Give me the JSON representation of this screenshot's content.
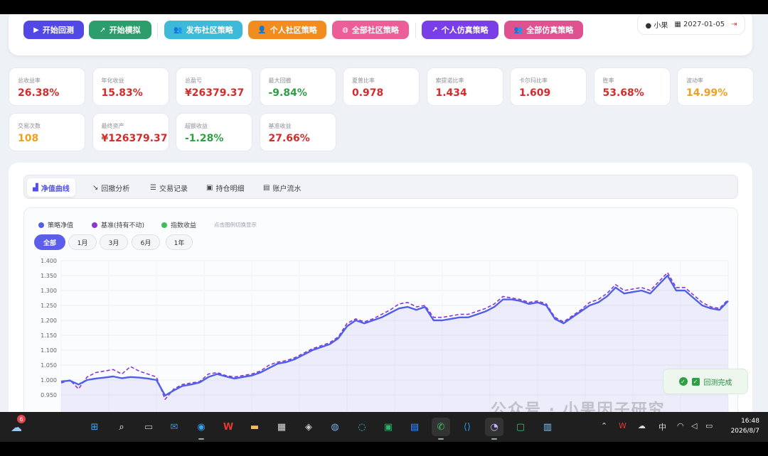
{
  "toolbar": {
    "buttons": [
      {
        "label": "开始回测",
        "icon": "play-icon",
        "color": "#5148e6",
        "glyph": "▶"
      },
      {
        "label": "开始模拟",
        "icon": "rocket-icon",
        "color": "#2c9d6c",
        "glyph": "➚"
      },
      {
        "label": "发布社区策略",
        "icon": "users-icon",
        "color": "#3fb9d9",
        "glyph": "👥"
      },
      {
        "label": "个人社区策略",
        "icon": "user-plus-icon",
        "color": "#f28c1e",
        "glyph": "👤"
      },
      {
        "label": "全部社区策略",
        "icon": "globe-icon",
        "color": "#ec5e97",
        "glyph": "◍"
      },
      {
        "label": "个人仿真策略",
        "icon": "chart-line-icon",
        "color": "#7a3ee8",
        "glyph": "↗"
      },
      {
        "label": "全部仿真策略",
        "icon": "users-icon",
        "color": "#e0528f",
        "glyph": "👥"
      }
    ],
    "user": {
      "name": "小果",
      "date": "2027-01-05"
    }
  },
  "metrics": [
    {
      "label": "总收益率",
      "value": "26.38%",
      "color": "#d42c2c"
    },
    {
      "label": "年化收益",
      "value": "15.83%",
      "color": "#d42c2c"
    },
    {
      "label": "总盈亏",
      "value": "¥26379.37",
      "color": "#d42c2c"
    },
    {
      "label": "最大回撤",
      "value": "-9.84%",
      "color": "#2f9e44"
    },
    {
      "label": "夏普比率",
      "value": "0.978",
      "color": "#d42c2c"
    },
    {
      "label": "索提诺比率",
      "value": "1.434",
      "color": "#d42c2c"
    },
    {
      "label": "卡尔玛比率",
      "value": "1.609",
      "color": "#d42c2c"
    },
    {
      "label": "胜率",
      "value": "53.68%",
      "color": "#d42c2c"
    },
    {
      "label": "波动率",
      "value": "14.99%",
      "color": "#f0a020"
    },
    {
      "label": "交易次数",
      "value": "108",
      "color": "#f0a020"
    },
    {
      "label": "最终资产",
      "value": "¥126379.37",
      "color": "#d42c2c"
    },
    {
      "label": "超额收益",
      "value": "-1.28%",
      "color": "#2f9e44"
    },
    {
      "label": "基准收益",
      "value": "27.66%",
      "color": "#d42c2c"
    }
  ],
  "tabs": [
    {
      "label": "净值曲线",
      "icon": "chart-area-icon",
      "glyph": "▟"
    },
    {
      "label": "回撤分析",
      "icon": "chart-line-icon",
      "glyph": "↘"
    },
    {
      "label": "交易记录",
      "icon": "list-icon",
      "glyph": "☰"
    },
    {
      "label": "持仓明细",
      "icon": "briefcase-icon",
      "glyph": "▣"
    },
    {
      "label": "账户流水",
      "icon": "ledger-icon",
      "glyph": "▤"
    }
  ],
  "legend": {
    "items": [
      {
        "label": "策略净值",
        "color": "#4f5fe6"
      },
      {
        "label": "基准(持有不动)",
        "color": "#8a36d8"
      },
      {
        "label": "指数收益",
        "color": "#3bbf5a"
      }
    ],
    "hint": "点击图例切换显示"
  },
  "ranges": [
    "全部",
    "1月",
    "3月",
    "6月",
    "1年"
  ],
  "chart_data": {
    "type": "line",
    "ylim": [
      0.9,
      1.4
    ],
    "yticks": [
      "1.400",
      "1.350",
      "1.300",
      "1.250",
      "1.200",
      "1.150",
      "1.100",
      "1.050",
      "1.000",
      "0.950"
    ],
    "series": [
      {
        "name": "策略净值",
        "color": "#4f5fe6",
        "values": [
          0.995,
          0.998,
          0.985,
          1.0,
          1.005,
          1.008,
          1.012,
          1.006,
          1.01,
          1.008,
          1.005,
          1.0,
          0.948,
          0.965,
          0.98,
          0.985,
          0.992,
          1.01,
          1.02,
          1.012,
          1.005,
          1.01,
          1.015,
          1.025,
          1.04,
          1.055,
          1.06,
          1.07,
          1.085,
          1.1,
          1.11,
          1.12,
          1.14,
          1.18,
          1.2,
          1.19,
          1.2,
          1.21,
          1.225,
          1.24,
          1.245,
          1.235,
          1.245,
          1.2,
          1.2,
          1.205,
          1.21,
          1.21,
          1.22,
          1.23,
          1.245,
          1.27,
          1.27,
          1.265,
          1.255,
          1.26,
          1.25,
          1.205,
          1.19,
          1.21,
          1.23,
          1.25,
          1.26,
          1.28,
          1.31,
          1.29,
          1.295,
          1.3,
          1.29,
          1.32,
          1.35,
          1.3,
          1.3,
          1.275,
          1.25,
          1.24,
          1.235,
          1.265
        ]
      },
      {
        "name": "基准(持有不动)",
        "color": "#8a36d8",
        "dashed": true,
        "values": [
          0.99,
          1.0,
          0.97,
          1.01,
          1.025,
          1.03,
          1.035,
          1.02,
          1.045,
          1.03,
          1.02,
          1.01,
          0.935,
          0.97,
          0.985,
          0.99,
          0.995,
          1.02,
          1.025,
          1.015,
          1.01,
          1.015,
          1.02,
          1.03,
          1.05,
          1.06,
          1.065,
          1.075,
          1.09,
          1.105,
          1.115,
          1.125,
          1.145,
          1.19,
          1.205,
          1.195,
          1.205,
          1.22,
          1.235,
          1.255,
          1.26,
          1.245,
          1.25,
          1.21,
          1.21,
          1.215,
          1.22,
          1.22,
          1.23,
          1.24,
          1.255,
          1.28,
          1.275,
          1.27,
          1.26,
          1.265,
          1.255,
          1.21,
          1.195,
          1.215,
          1.235,
          1.26,
          1.27,
          1.29,
          1.32,
          1.3,
          1.305,
          1.31,
          1.3,
          1.33,
          1.36,
          1.31,
          1.31,
          1.285,
          1.26,
          1.245,
          1.24,
          1.27
        ]
      }
    ]
  },
  "toast": {
    "label": "回测完成"
  },
  "watermark": "公众号 · 小果因子研究",
  "taskbar": {
    "weather_badge": "6",
    "ime": "中",
    "time": "16:48",
    "date": "2026/8/7"
  }
}
